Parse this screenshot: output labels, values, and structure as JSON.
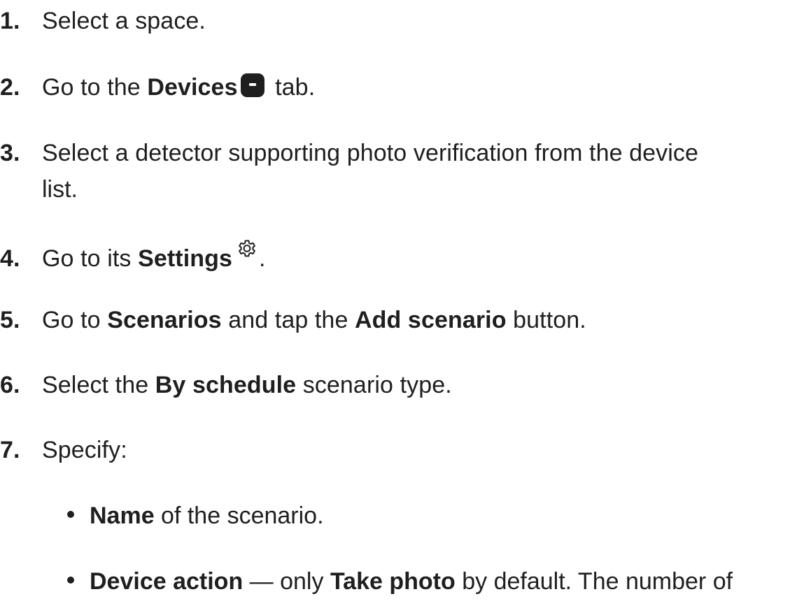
{
  "steps": [
    {
      "num": "1.",
      "text": "Select a space."
    },
    {
      "num": "2.",
      "pre": "Go to the ",
      "bold": "Devices",
      "post": " tab."
    },
    {
      "num": "3.",
      "line1": "Select a detector supporting photo verification from the device",
      "line2": "list."
    },
    {
      "num": "4.",
      "pre": "Go to its ",
      "bold": "Settings",
      "post": "."
    },
    {
      "num": "5.",
      "pre": "Go to ",
      "bold1": "Scenarios",
      "mid": " and tap the ",
      "bold2": "Add scenario",
      "post": " button."
    },
    {
      "num": "6.",
      "pre": "Select the ",
      "bold": "By schedule",
      "post": " scenario type."
    },
    {
      "num": "7.",
      "text": "Specify:"
    }
  ],
  "bullets": [
    {
      "bold": "Name",
      "text": " of the scenario."
    },
    {
      "bold": "Device action",
      "mid": " — only ",
      "bold2": "Take photo",
      "text": " by default. The number of"
    }
  ],
  "icons": {
    "devices_tab": "devices-icon",
    "settings": "gear-icon"
  }
}
